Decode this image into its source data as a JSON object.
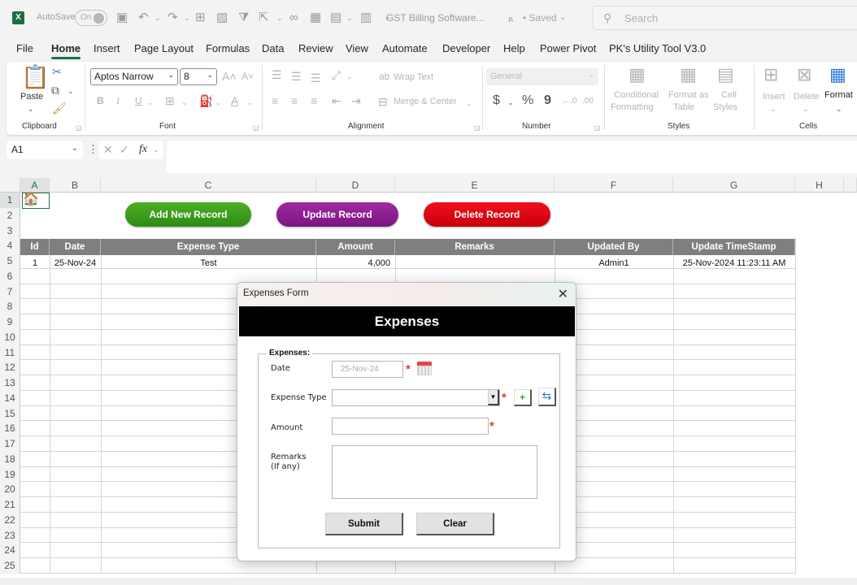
{
  "titlebar": {
    "app_icon": "excel-icon",
    "autosave_label": "AutoSave",
    "autosave_state": "On",
    "doc_title": "GST Billing Software...",
    "saved_status": "• Saved",
    "search_placeholder": "Search"
  },
  "tabs": [
    "File",
    "Home",
    "Insert",
    "Page Layout",
    "Formulas",
    "Data",
    "Review",
    "View",
    "Automate",
    "Developer",
    "Help",
    "Power Pivot",
    "PK's Utility Tool V3.0"
  ],
  "active_tab": "Home",
  "ribbon": {
    "clipboard": {
      "label": "Clipboard",
      "paste": "Paste"
    },
    "font": {
      "label": "Font",
      "font_name": "Aptos Narrow",
      "font_size": "8",
      "bold": "B",
      "italic": "I",
      "underline": "U"
    },
    "alignment": {
      "label": "Alignment",
      "wrap_text": "Wrap Text",
      "merge_center": "Merge & Center"
    },
    "number": {
      "label": "Number",
      "format": "General",
      "currency": "$",
      "percent": "%",
      "comma": "9"
    },
    "styles": {
      "label": "Styles",
      "conditional": "Conditional",
      "conditional2": "Formatting",
      "format_table": "Format as",
      "format_table2": "Table",
      "cell_styles": "Cell",
      "cell_styles2": "Styles"
    },
    "cells": {
      "label": "Cells",
      "insert": "Insert",
      "delete": "Delete",
      "format": "Format"
    }
  },
  "formula_bar": {
    "name_box": "A1",
    "formula": ""
  },
  "columns": [
    "A",
    "B",
    "C",
    "D",
    "E",
    "F",
    "G",
    "H"
  ],
  "rows": [
    "1",
    "2",
    "3",
    "4",
    "5",
    "6",
    "7",
    "8",
    "9",
    "10",
    "11",
    "12",
    "13",
    "14",
    "15",
    "16",
    "17",
    "18",
    "19",
    "20",
    "21",
    "22",
    "23",
    "24",
    "25"
  ],
  "sheet_buttons": {
    "add": "Add New Record",
    "update": "Update Record",
    "delete": "Delete Record"
  },
  "sheet_button_colors": {
    "add": "#3c9a1f",
    "update": "#8b1e8f",
    "delete": "#e00010"
  },
  "table": {
    "headers": [
      "Id",
      "Date",
      "Expense Type",
      "Amount",
      "Remarks",
      "Updated By",
      "Update TimeStamp"
    ],
    "rows": [
      [
        "1",
        "25-Nov-24",
        "Test",
        "4,000",
        "",
        "Admin1",
        "25-Nov-2024 11:23:11 AM"
      ]
    ]
  },
  "dialog": {
    "window_title": "Expenses Form",
    "banner": "Expenses",
    "frame_legend": "Expenses:",
    "date_label": "Date",
    "date_value": "25-Nov-24",
    "expense_type_label": "Expense Type",
    "expense_type_value": "",
    "amount_label": "Amount",
    "amount_value": "",
    "remarks_label": "Remarks",
    "remarks_sub": "(If any)",
    "remarks_value": "",
    "required_mark": "*",
    "add_type_btn": "+",
    "submit": "Submit",
    "clear": "Clear"
  }
}
